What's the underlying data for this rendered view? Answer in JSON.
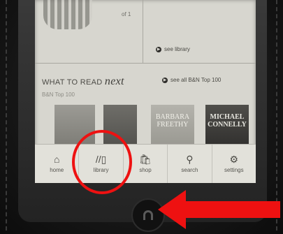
{
  "top_left": {
    "count_text": "of 1"
  },
  "top_right": {
    "see_library": "see library"
  },
  "what_to_read": {
    "title_prefix": "WHAT TO READ",
    "title_next": "next",
    "see_all": "see all B&N Top 100",
    "subtitle": "B&N Top 100"
  },
  "covers": [
    {
      "text": ""
    },
    {
      "text": ""
    },
    {
      "text": "BARBARA FREETHY"
    },
    {
      "text": "MICHAEL CONNELLY"
    }
  ],
  "nav": [
    {
      "label": "home",
      "icon": "home-icon"
    },
    {
      "label": "library",
      "icon": "library-icon"
    },
    {
      "label": "shop",
      "icon": "shop-icon"
    },
    {
      "label": "search",
      "icon": "search-icon"
    },
    {
      "label": "settings",
      "icon": "gear-icon"
    }
  ],
  "annotation_colors": {
    "highlight": "#e11"
  }
}
